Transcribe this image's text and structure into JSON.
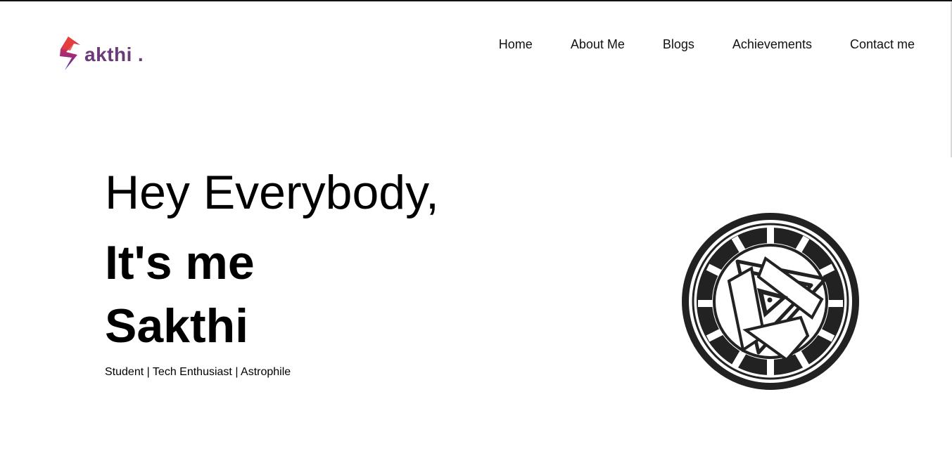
{
  "logo": {
    "text": "akthi",
    "dot": ".",
    "icon": "lightning-s-icon",
    "colors": {
      "top": "#e8403a",
      "mid": "#b02a6e",
      "bottom": "#4b2bb5",
      "text": "#6b3a7a"
    }
  },
  "nav": {
    "items": [
      {
        "label": "Home"
      },
      {
        "label": "About Me"
      },
      {
        "label": "Blogs"
      },
      {
        "label": "Achievements"
      },
      {
        "label": "Contact me"
      }
    ]
  },
  "hero": {
    "greeting": "Hey Everybody,",
    "intro": "It's me",
    "name": "Sakthi",
    "tagline": "Student | Tech Enthusiast | Astrophile"
  },
  "illustration": {
    "icon": "arc-reactor-icon"
  }
}
